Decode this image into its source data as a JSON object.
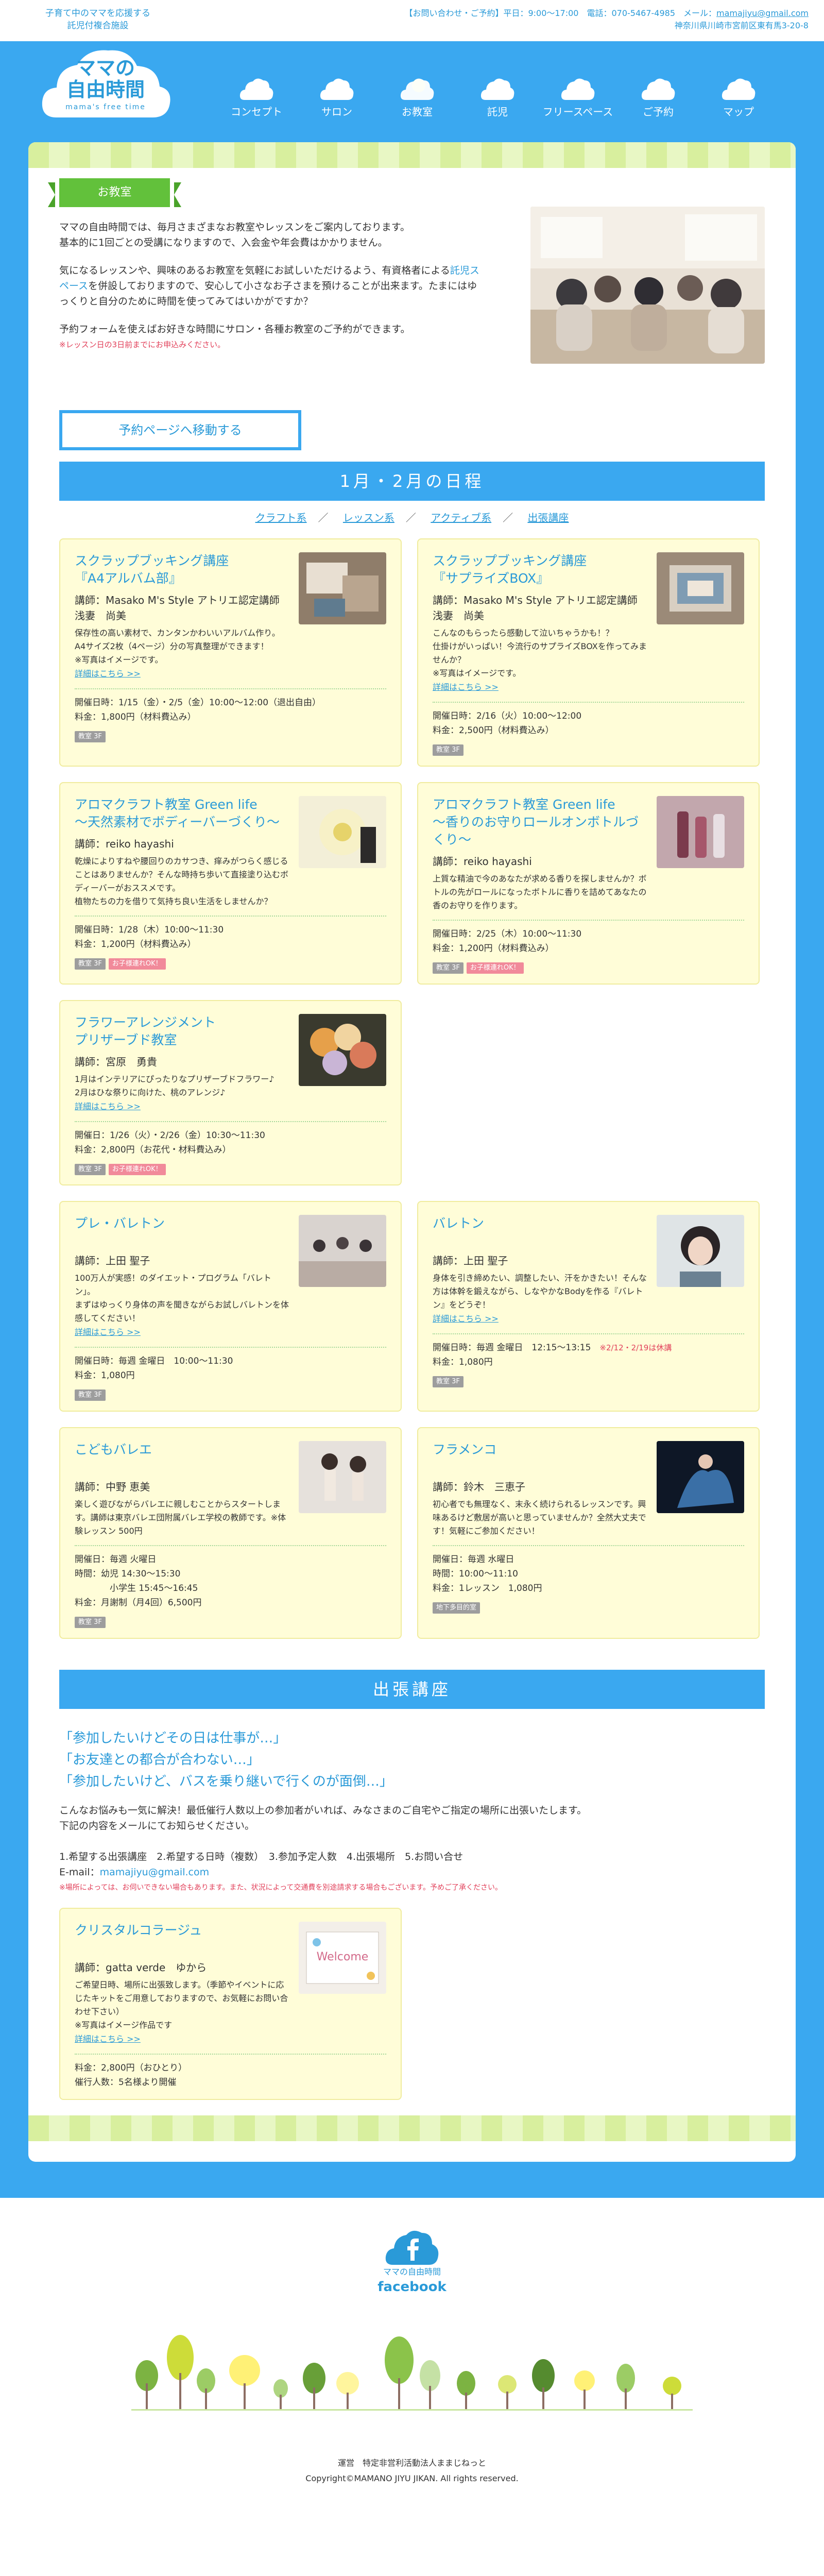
{
  "topbar": {
    "tagline": "子育て中のママを応援する\n託児付複合施設",
    "contact_line": "【お問い合わせ・ご予約】平日：9:00〜17:00　電話：070-5467-4985　メール：",
    "email": "mamajiyu@gmail.com",
    "address": "神奈川県川崎市宮前区東有馬3-20-8"
  },
  "logo": {
    "line1": "ママの",
    "line2": "自由時間",
    "sub": "mama's free time"
  },
  "nav": [
    {
      "label": "コンセプト"
    },
    {
      "label": "サロン"
    },
    {
      "label": "お教室"
    },
    {
      "label": "託児"
    },
    {
      "label": "フリースペース"
    },
    {
      "label": "ご予約"
    },
    {
      "label": "マップ"
    }
  ],
  "intro": {
    "ribbon": "お教室",
    "p1": "ママの自由時間では、毎月さまざまなお教室やレッスンをご案内しております。\n基本的に1回ごとの受講になりますので、入会金や年会費はかかりません。",
    "p2_before": "気になるレッスンや、興味のあるお教室を気軽にお試しいただけるよう、有資格者による",
    "p2_link": "託児スペース",
    "p2_after": "を併設しておりますので、安心して小さなお子さまを預けることが出来ます。たまにはゆっくりと自分のために時間を使ってみてはいかがですか？",
    "p3": "予約フォームを使えばお好きな時間にサロン・各種お教室のご予約ができます。",
    "note": "※レッスン日の3日前までにお申込みください。",
    "button": "予約ページへ移動する"
  },
  "schedule": {
    "title": "1月・2月の日程",
    "categories": [
      "クラフト系",
      "レッスン系",
      "アクティブ系",
      "出張講座"
    ],
    "separator": "／"
  },
  "group1": [
    {
      "title": "スクラップブッキング講座\n『A4アルバム部』",
      "teacher": "講師：Masako M's Style アトリエ認定講師　浅妻　尚美",
      "desc": "保存性の高い素材で、カンタンかわいいアルバム作り。\nA4サイズ2枚（4ページ）分の写真整理ができます！\n※写真はイメージです。",
      "more": "詳細はこちら >>",
      "info": [
        "開催日時：1/15（金）・2/5（金）10:00〜12:00（退出自由）",
        "料金：1,800円（材料費込み）"
      ],
      "info_red": "",
      "tags": [
        {
          "text": "教室 3F",
          "color": "gray"
        }
      ]
    },
    {
      "title": "スクラップブッキング講座\n『サプライズBOX』",
      "teacher": "講師：Masako M's Style アトリエ認定講師　浅妻　尚美",
      "desc": "こんなのもらったら感動して泣いちゃうかも！？\n仕掛けがいっぱい！今流行のサプライズBOXを作ってみませんか？\n※写真はイメージです。",
      "more": "詳細はこちら >>",
      "info": [
        "開催日時：2/16（火）10:00〜12:00",
        "料金：2,500円（材料費込み）"
      ],
      "info_red": "",
      "tags": [
        {
          "text": "教室 3F",
          "color": "gray"
        }
      ]
    },
    {
      "title": "アロマクラフト教室 Green life\n〜天然素材でボディーバーづくり〜",
      "teacher": "講師：reiko hayashi",
      "desc": "乾燥によりすねや腰回りのカサつき、痒みがつらく感じることはありませんか？そんな時持ち歩いて直接塗り込むボディーバーがおススメです。\n植物たちの力を借りて気持ち良い生活をしませんか？",
      "more": "",
      "info": [
        "開催日時：1/28（木）10:00〜11:30",
        "料金：1,200円（材料費込み）"
      ],
      "info_red": "",
      "tags": [
        {
          "text": "教室 3F",
          "color": "gray"
        },
        {
          "text": "お子様連れOK！",
          "color": "pink"
        }
      ]
    },
    {
      "title": "アロマクラフト教室 Green life\n〜香りのお守りロールオンボトルづくり〜",
      "teacher": "講師：reiko hayashi",
      "desc": "上質な精油で今のあなたが求める香りを探しませんか？ボトルの先がロールになったボトルに香りを詰めてあなたの香のお守りを作ります。",
      "more": "",
      "info": [
        "開催日時：2/25（木）10:00〜11:30",
        "料金：1,200円（材料費込み）"
      ],
      "info_red": "",
      "tags": [
        {
          "text": "教室 3F",
          "color": "gray"
        },
        {
          "text": "お子様連れOK！",
          "color": "pink"
        }
      ]
    },
    {
      "title": "フラワーアレンジメント\nプリザーブド教室",
      "teacher": "講師：宮原　勇貴",
      "desc": "1月はインテリアにぴったりなプリザーブドフラワー♪\n2月はひな祭りに向けた、桃のアレンジ♪",
      "more": "詳細はこちら >>",
      "info": [
        "開催日：1/26（火）・2/26（金）10:30〜11:30",
        "料金：2,800円（お花代・材料費込み）"
      ],
      "info_red": "",
      "tags": [
        {
          "text": "教室 3F",
          "color": "gray"
        },
        {
          "text": "お子様連れOK！",
          "color": "pink"
        }
      ]
    }
  ],
  "group2": [
    {
      "title": "プレ・バレトン",
      "teacher": "講師：上田 聖子",
      "desc": "100万人が実感！のダイエット・プログラム「バレトン」。\nまずはゆっくり身体の声を聞きながらお試しバレトンを体感してください！",
      "more": "詳細はこちら >>",
      "info": [
        "開催日時：毎週 金曜日　10:00〜11:30",
        "料金：1,080円"
      ],
      "info_red": "",
      "tags": [
        {
          "text": "教室 3F",
          "color": "gray"
        }
      ]
    },
    {
      "title": "バレトン",
      "teacher": "講師：上田 聖子",
      "desc": "身体を引き締めたい、調整したい、汗をかきたい！そんな方は体幹を鍛えながら、しなやかなBodyを作る『バレトン』をどうぞ！",
      "more": "詳細はこちら >>",
      "info": [
        "開催日時：毎週 金曜日　12:15〜13:15",
        "料金：1,080円"
      ],
      "info_red": "※2/12・2/19は休講",
      "tags": [
        {
          "text": "教室 3F",
          "color": "gray"
        }
      ]
    },
    {
      "title": "こどもバレエ",
      "teacher": "講師：中野 恵美",
      "desc": "楽しく遊びながらバレエに親しむことからスタートします。講師は東京バレエ団附属バレエ学校の教師です。※体験レッスン 500円",
      "more": "",
      "info": [
        "開催日：毎週 火曜日",
        "時間：幼児 14:30〜15:30",
        "　　　　小学生 15:45〜16:45",
        "料金：月謝制（月4回）6,500円"
      ],
      "info_red": "",
      "tags": [
        {
          "text": "教室 3F",
          "color": "gray"
        }
      ]
    },
    {
      "title": "フラメンコ",
      "teacher": "講師：鈴木　三恵子",
      "desc": "初心者でも無理なく、末永く続けられるレッスンです。興味あるけど敷居が高いと思っていませんか？全然大丈夫です！気軽にご参加ください！",
      "more": "",
      "info": [
        "開催日：毎週 水曜日",
        "時間：10:00〜11:10",
        "料金：1レッスン　1,080円"
      ],
      "info_red": "",
      "tags": [
        {
          "text": "地下多目的室",
          "color": "gray"
        }
      ]
    }
  ],
  "outreach": {
    "title": "出張講座",
    "catch": [
      "「参加したいけどその日は仕事が…」",
      "「お友達との都合が合わない…」",
      "「参加したいけど、バスを乗り継いで行くのが面倒…」"
    ],
    "p1": "こんなお悩みも一気に解決！最低催行人数以上の参加者がいれば、みなさまのご自宅やご指定の場所に出張いたします。\n下記の内容をメールにてお知らせください。",
    "steps": "1.希望する出張講座　2.希望する日時（複数）　3.参加予定人数　4.出張場所　5.お問い合せ",
    "email_label": "E-mail：",
    "email": "mamajiyu@gmail.com",
    "note": "※場所によっては、お伺いできない場合もあります。また、状況によって交通費を別途請求する場合もございます。予めご了承ください。",
    "card": {
      "title": "クリスタルコラージュ",
      "teacher": "講師：gatta verde　ゆから",
      "desc": "ご希望日時、場所に出張致します。（季節やイベントに応じたキットをご用意しておりますので、お気軽にお問い合わせ下さい）\n※写真はイメージ作品です",
      "more": "詳細はこちら >>",
      "info": [
        "料金：2,800円（おひとり）",
        "催行人数：5名様より開催"
      ]
    }
  },
  "footer": {
    "fb_name": "ママの自由時間",
    "fb_label": "facebook",
    "operator": "運営　特定非営利活動法人ままじねっと",
    "copyright": "Copyright©MAMANO JIYU JIKAN. All rights reserved."
  },
  "colors": {
    "brand_blue": "#3aa8f0",
    "card_yellow": "#fffdd8",
    "ribbon_green": "#62c13b",
    "accent_red": "#e2405a"
  }
}
